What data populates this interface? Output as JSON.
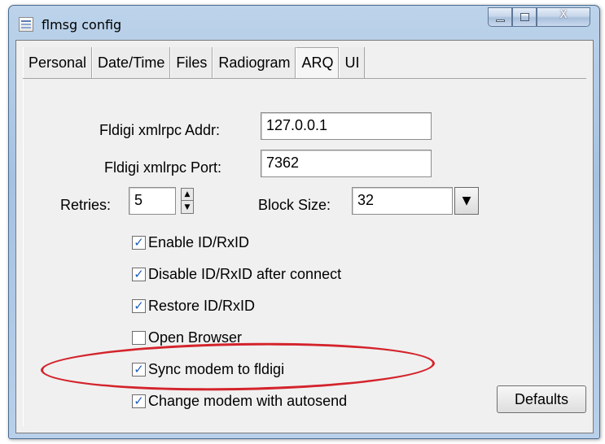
{
  "window": {
    "title": "flmsg config",
    "close_glyph": "X",
    "icon": "app-icon"
  },
  "tabs": [
    {
      "label": "Personal",
      "active": false
    },
    {
      "label": "Date/Time",
      "active": false
    },
    {
      "label": "Files",
      "active": false
    },
    {
      "label": "Radiogram",
      "active": false
    },
    {
      "label": "ARQ",
      "active": true
    },
    {
      "label": "UI",
      "active": false
    }
  ],
  "arq": {
    "addr_label": "Fldigi xmlrpc Addr:",
    "addr_value": "127.0.0.1",
    "port_label": "Fldigi xmlrpc Port:",
    "port_value": "7362",
    "retries_label": "Retries:",
    "retries_value": "5",
    "block_size_label": "Block Size:",
    "block_size_value": "32",
    "checkboxes": [
      {
        "label": "Enable ID/RxID",
        "checked": true
      },
      {
        "label": "Disable ID/RxID after connect",
        "checked": true
      },
      {
        "label": "Restore ID/RxID",
        "checked": true
      },
      {
        "label": "Open Browser",
        "checked": false
      },
      {
        "label": "Sync modem to fldigi",
        "checked": true
      },
      {
        "label": "Change modem with autosend",
        "checked": true
      }
    ],
    "defaults_label": "Defaults"
  },
  "annotation": {
    "color": "#d4232b",
    "target": "Sync modem to fldigi"
  }
}
